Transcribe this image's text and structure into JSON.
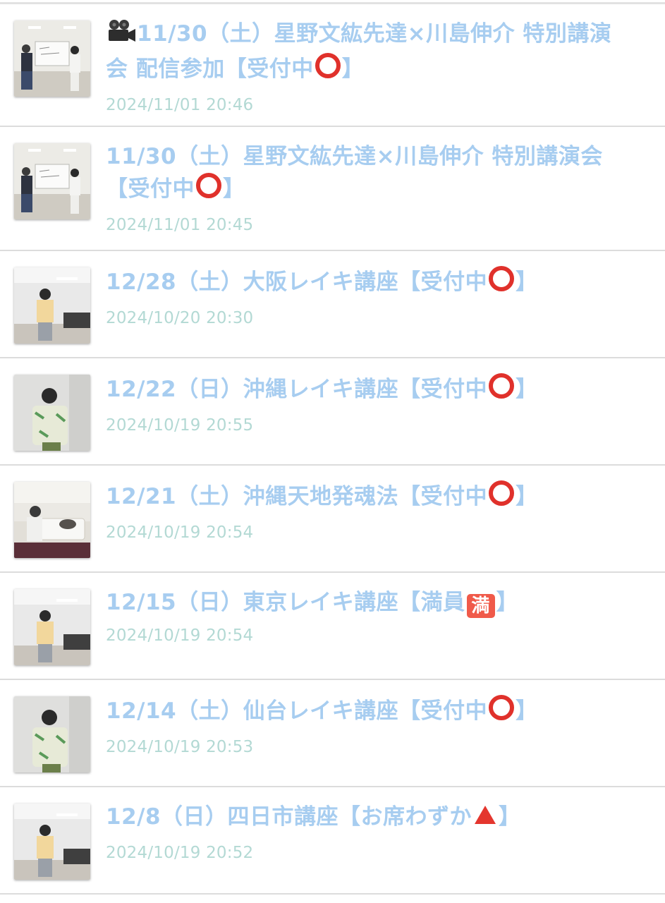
{
  "items": [
    {
      "title_lines": [
        "11/30（土）星野文紘先達×川島伸介 特別講演",
        "会 配信参加【受付中",
        "】"
      ],
      "lead_icon": "movie-camera-icon",
      "status_icon": "red-circle-icon",
      "date": "2024/11/01 20:46",
      "thumb": "duo-whiteboard"
    },
    {
      "title_a": "11/30（土）星野文紘先達×川島伸介 特別講演会",
      "title_b": "【受付中",
      "title_c": "】",
      "status_icon": "red-circle-icon",
      "date": "2024/11/01 20:45",
      "thumb": "duo-whiteboard"
    },
    {
      "title_a": "12/28（土）大阪レイキ講座【受付中",
      "title_c": "】",
      "status_icon": "red-circle-icon",
      "date": "2024/10/20 20:30",
      "thumb": "man-yellow-room"
    },
    {
      "title_a": "12/22（日）沖縄レイキ講座【受付中",
      "title_c": "】",
      "status_icon": "red-circle-icon",
      "date": "2024/10/19 20:55",
      "thumb": "man-green-jacket"
    },
    {
      "title_a": "12/21（土）沖縄天地発魂法【受付中",
      "title_c": "】",
      "status_icon": "red-circle-icon",
      "date": "2024/10/19 20:54",
      "thumb": "session-bed"
    },
    {
      "title_a": "12/15（日）東京レイキ講座【満員",
      "title_c": "】",
      "status_icon": "full-badge-icon",
      "status_text": "満",
      "date": "2024/10/19 20:54",
      "thumb": "man-yellow-room"
    },
    {
      "title_a": "12/14（土）仙台レイキ講座【受付中",
      "title_c": "】",
      "status_icon": "red-circle-icon",
      "date": "2024/10/19 20:53",
      "thumb": "man-green-jacket"
    },
    {
      "title_a": "12/8（日）四日市講座【お席わずか",
      "title_c": "】",
      "status_icon": "red-triangle-icon",
      "date": "2024/10/19 20:52",
      "thumb": "man-yellow-room"
    }
  ],
  "colors": {
    "title": "#a7cdf0",
    "date": "#b3d9d4",
    "divider": "#dcdcdc",
    "status_circle": "#e0312b",
    "status_triangle": "#e4362e",
    "full_badge": "#f05a4a"
  }
}
